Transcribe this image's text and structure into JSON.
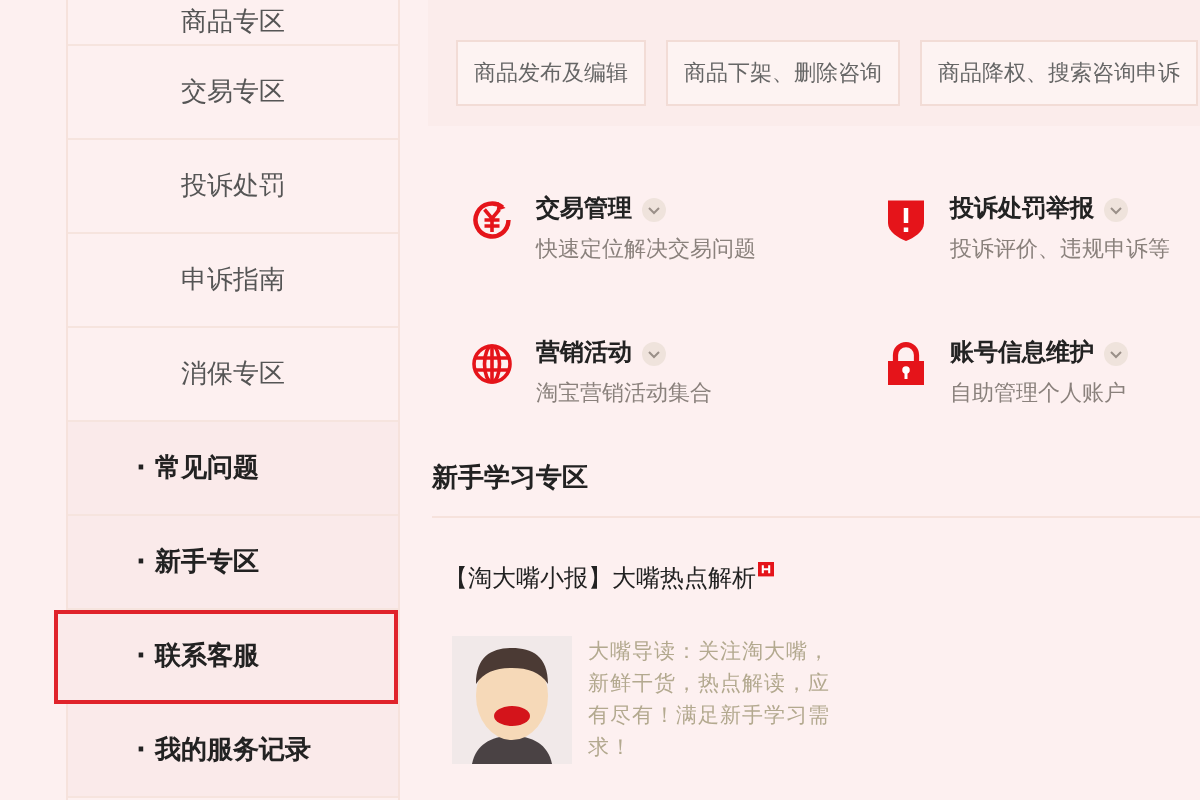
{
  "sidebar": {
    "items": [
      {
        "kind": "sub",
        "label": "商品专区",
        "selected": false
      },
      {
        "kind": "sub",
        "label": "交易专区",
        "selected": false
      },
      {
        "kind": "sub",
        "label": "投诉处罚",
        "selected": false
      },
      {
        "kind": "sub",
        "label": "申诉指南",
        "selected": false
      },
      {
        "kind": "sub",
        "label": "消保专区",
        "selected": false
      },
      {
        "kind": "main",
        "label": "· 常见问题",
        "selected": false
      },
      {
        "kind": "main",
        "label": "· 新手专区",
        "selected": false
      },
      {
        "kind": "main",
        "label": "· 联系客服",
        "selected": true
      },
      {
        "kind": "main",
        "label": "· 我的服务记录",
        "selected": false
      }
    ]
  },
  "tags": [
    "商品发布及编辑",
    "商品下架、删除咨询",
    "商品降权、搜索咨询申诉"
  ],
  "quick_links": [
    {
      "kind": "yen",
      "title": "交易管理",
      "desc": "快速定位解决交易问题"
    },
    {
      "kind": "shield",
      "title": "投诉处罚举报",
      "desc": "投诉评价、违规申诉等"
    },
    {
      "kind": "globe",
      "title": "营销活动",
      "desc": "淘宝营销活动集合"
    },
    {
      "kind": "lock",
      "title": "账号信息维护",
      "desc": "自助管理个人账户"
    }
  ],
  "learning": {
    "heading": "新手学习专区",
    "article": {
      "title": "【淘大嘴小报】大嘴热点解析",
      "hot": true,
      "summary": "大嘴导读：关注淘大嘴，新鲜干货，热点解读，应有尽有！满足新手学习需求！"
    }
  }
}
